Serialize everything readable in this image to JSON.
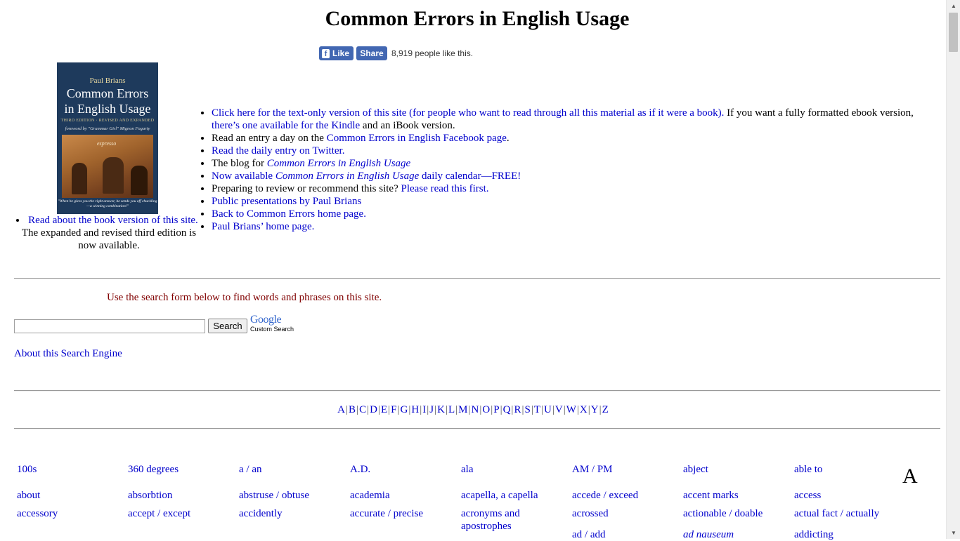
{
  "page": {
    "title": "Common Errors in English Usage"
  },
  "facebook": {
    "like_label": "Like",
    "share_label": "Share",
    "count_text": "8,919 people like this."
  },
  "book_cover": {
    "author": "Paul Brians",
    "title_line1": "Common Errors",
    "title_line2": "in English Usage",
    "edition": "THIRD EDITION · REVISED AND EXPANDED",
    "foreword": "foreword by \"Grammar Girl\" Mignon Fogarty",
    "art_label": "espresso",
    "quote": "\"When he gives you the right answer, he sends you off chuckling—a winning combination!\""
  },
  "left_caption": {
    "link": "Read about the book version of this site.",
    "text": "The expanded and revised third edition is now available."
  },
  "links": {
    "item1_link": "Click here for the text-only version of this site (for people who want to read through all this material as if it were a book).",
    "item1_text_a": " If you want a fully formatted ebook version, ",
    "item1_link_b": "there’s one available for the Kindle",
    "item1_text_b": " and an iBook version.",
    "item2_text": "Read an entry a day on the ",
    "item2_link": "Common Errors in English Facebook page",
    "item2_end": ".",
    "item3_link": "Read the daily entry on Twitter.",
    "item4_text": "The blog for ",
    "item4_link": "Common Errors in English Usage",
    "item5_link_a": "Now available ",
    "item5_link_b": "Common Errors in English Usage",
    "item5_link_c": " daily calendar—FREE!",
    "item6_text": "Preparing to review or recommend this site? ",
    "item6_link": "Please read this first.",
    "item7_link": "Public presentations by Paul Brians",
    "item8_link": "Back to Common Errors home page.",
    "item9_link": "Paul Brians’ home page."
  },
  "search": {
    "intro": "Use the search form below to find words and phrases on this site.",
    "input_value": "",
    "button_label": "Search",
    "google_label": "Google",
    "custom_search_label": "Custom Search",
    "about_link": "About this Search Engine"
  },
  "alphabet": [
    "A",
    "B",
    "C",
    "D",
    "E",
    "F",
    "G",
    "H",
    "I",
    "J",
    "K",
    "L",
    "M",
    "N",
    "O",
    "P",
    "Q",
    "R",
    "S",
    "T",
    "U",
    "V",
    "W",
    "X",
    "Y",
    "Z"
  ],
  "section_letter": "A",
  "entries": [
    [
      "100s",
      "360 degrees",
      "a / an",
      "A.D.",
      "ala",
      "AM / PM",
      "abject",
      "able to"
    ],
    [
      "about",
      "absorbtion",
      "abstruse / obtuse",
      "academia",
      "acapella, a capella",
      "accede / exceed",
      "accent marks",
      "access"
    ],
    [
      "accessory",
      "accept / except",
      "accidently",
      "accurate / precise",
      "acronyms and apostrophes",
      "acrossed",
      "actionable / doable",
      "actual fact / actually"
    ],
    [
      "",
      "",
      "",
      "",
      "",
      "ad / add",
      "ad nauseum",
      "addicting"
    ]
  ]
}
